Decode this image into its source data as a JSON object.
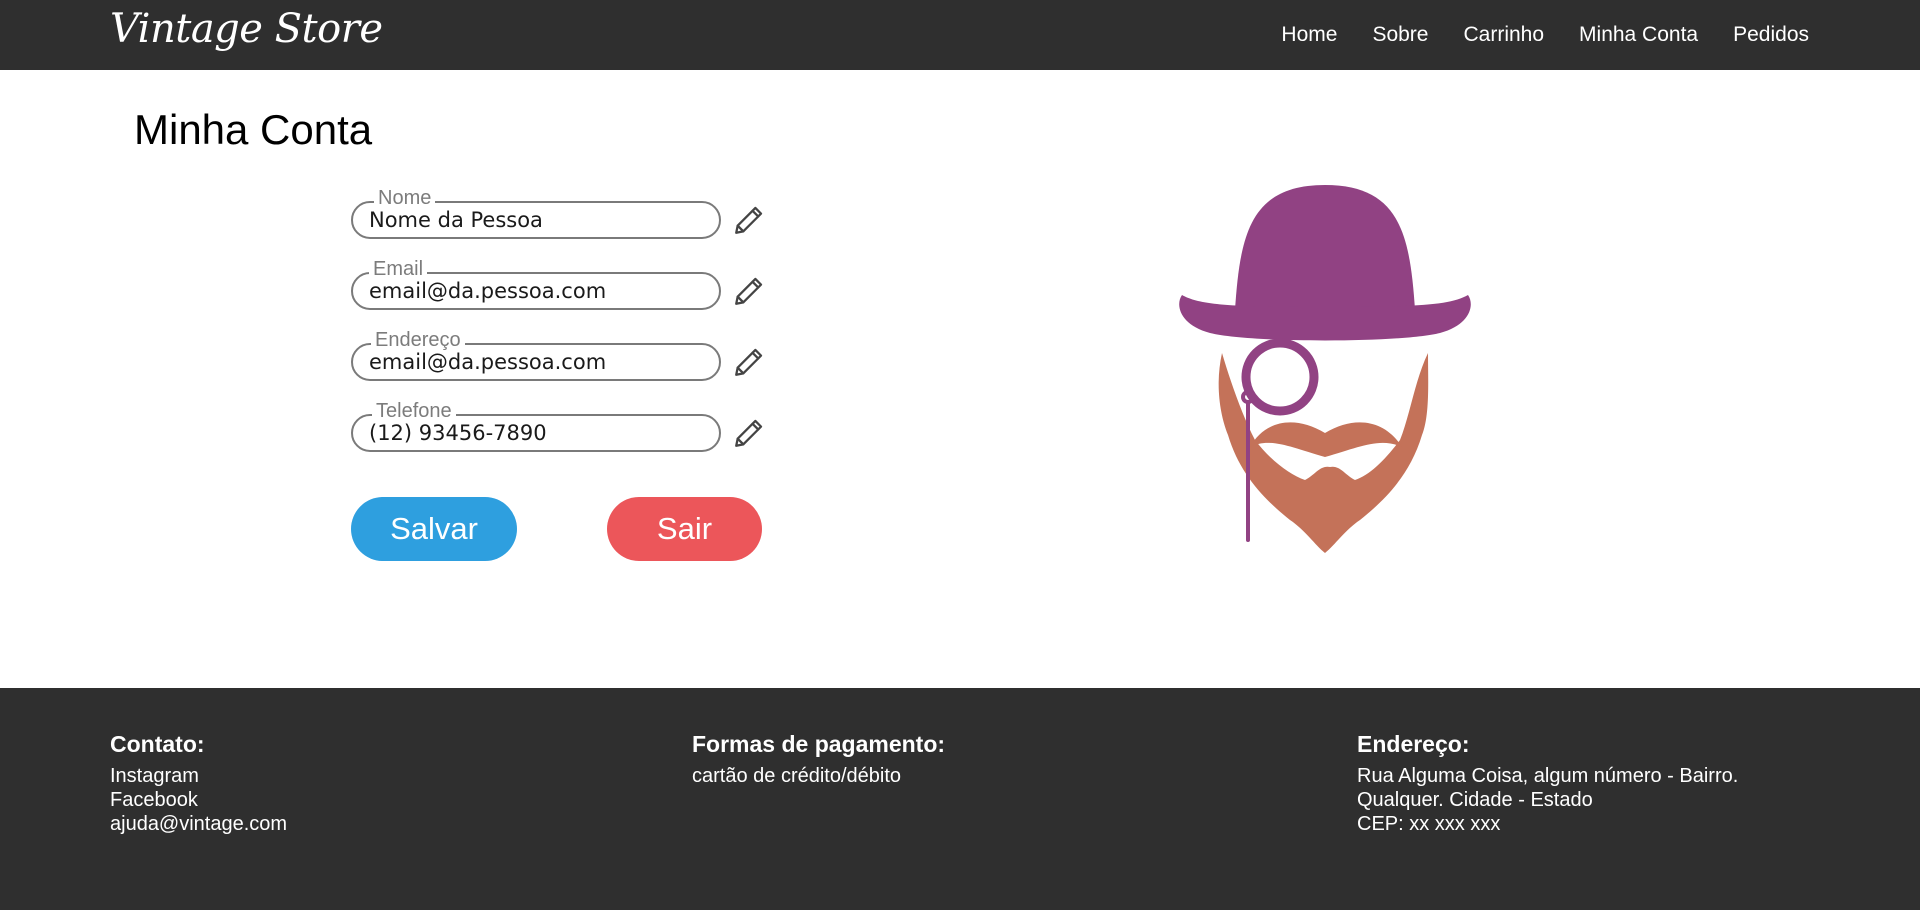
{
  "nav": {
    "brand": "Vintage Store",
    "links": [
      "Home",
      "Sobre",
      "Carrinho",
      "Minha Conta",
      "Pedidos"
    ]
  },
  "main": {
    "title": "Minha Conta",
    "fields": [
      {
        "label": "Nome",
        "value": "Nome da Pessoa"
      },
      {
        "label": "Email",
        "value": "email@da.pessoa.com"
      },
      {
        "label": "Endereço",
        "value": "email@da.pessoa.com"
      },
      {
        "label": "Telefone",
        "value": "(12) 93456-7890"
      }
    ],
    "save_label": "Salvar",
    "exit_label": "Sair"
  },
  "footer": {
    "contact": {
      "title": "Contato:",
      "lines": [
        "Instagram",
        "Facebook",
        "ajuda@vintage.com"
      ]
    },
    "payment": {
      "title": "Formas de pagamento:",
      "lines": [
        "cartão de crédito/débito"
      ]
    },
    "address": {
      "title": "Endereço:",
      "lines": [
        "Rua Alguma Coisa, algum número - Bairro.",
        "Qualquer. Cidade - Estado",
        "CEP: xx xxx xxx"
      ]
    }
  },
  "colors": {
    "nav_bg": "#2f2f2f",
    "save_button": "#2e9fdf",
    "exit_button": "#ec565a",
    "hat": "#914283",
    "beard": "#c47259"
  },
  "icons": {
    "edit": "pencil-icon",
    "avatar": "gentleman-avatar"
  }
}
